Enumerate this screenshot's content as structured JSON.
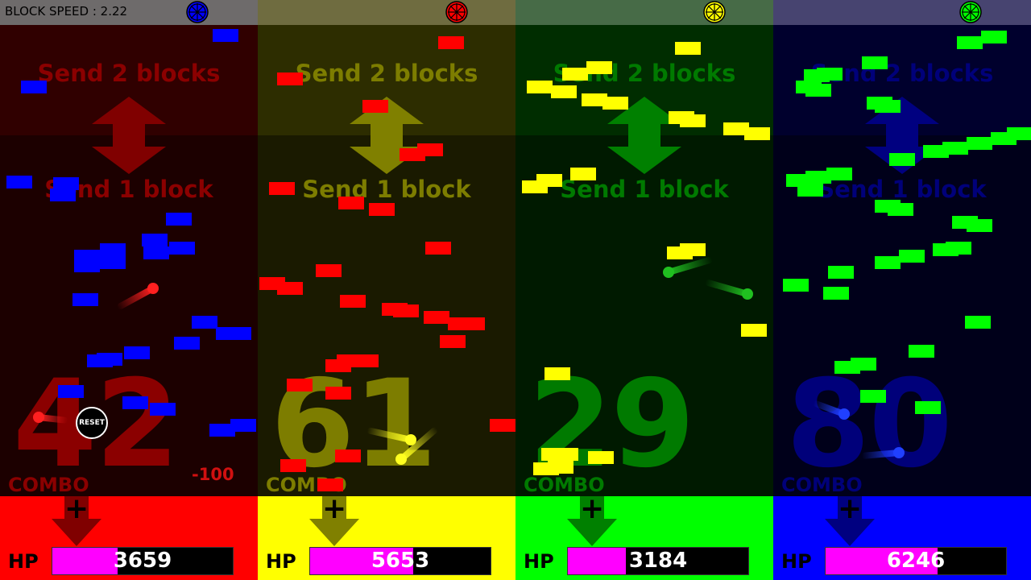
{
  "header": {
    "block_speed": "BLOCK SPEED : 2.22"
  },
  "reset_label": "RESET",
  "penalty_text": "-100",
  "players": [
    {
      "fruit": "blueberry-icon",
      "fruit_color": "#0000ff",
      "topbar": "#6e6b6b",
      "zone_top": "#300000",
      "zone_mid": "#1c0000",
      "text_color": "#8b0000",
      "bottom": "#ff0000",
      "arrow_color": "#800000",
      "send2": "Send 2 blocks",
      "send1": "Send 1 block",
      "combo": "42",
      "combo_label": "COMBO",
      "hp_label": "HP",
      "hp": "3659",
      "hp_fraction": 0.36,
      "block_color": "#0000ff"
    },
    {
      "fruit": "strawberry-icon",
      "fruit_color": "#ff0000",
      "topbar": "#6f6c40",
      "zone_top": "#2d2d00",
      "zone_mid": "#1a1a00",
      "text_color": "#7d7d00",
      "bottom": "#ffff00",
      "arrow_color": "#808000",
      "send2": "Send 2 blocks",
      "send1": "Send 1 block",
      "combo": "61",
      "combo_label": "COMBO",
      "hp_label": "HP",
      "hp": "5653",
      "hp_fraction": 0.57,
      "block_color": "#ff0000"
    },
    {
      "fruit": "lemon-icon",
      "fruit_color": "#ffff00",
      "topbar": "#476b47",
      "zone_top": "#002d00",
      "zone_mid": "#001a00",
      "text_color": "#007a00",
      "bottom": "#00ff00",
      "arrow_color": "#008000",
      "send2": "Send 2 blocks",
      "send1": "Send 1 block",
      "combo": "29",
      "combo_label": "COMBO",
      "hp_label": "HP",
      "hp": "3184",
      "hp_fraction": 0.32,
      "block_color": "#ffff00"
    },
    {
      "fruit": "lime-icon",
      "fruit_color": "#00ff00",
      "topbar": "#474470",
      "zone_top": "#00002d",
      "zone_mid": "#00001a",
      "text_color": "#00007a",
      "bottom": "#0000ff",
      "arrow_color": "#000080",
      "send2": "Send 2 blocks",
      "send1": "Send 1 block",
      "combo": "80",
      "combo_label": "COMBO",
      "hp_label": "HP",
      "hp": "6246",
      "hp_fraction": 0.62,
      "block_color": "#00ff00"
    }
  ]
}
